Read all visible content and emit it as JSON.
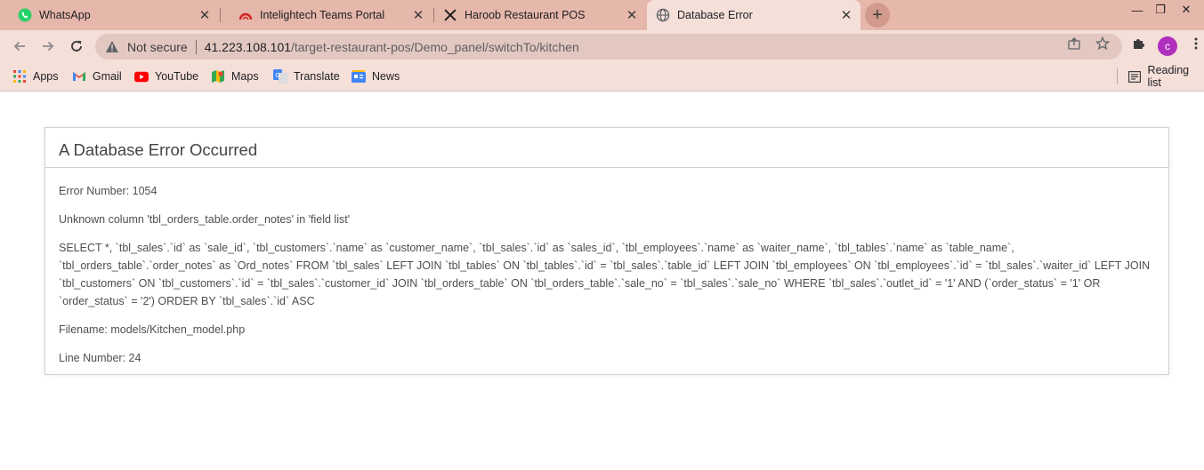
{
  "tabs": [
    {
      "title": "WhatsApp",
      "favicon": "whatsapp-icon",
      "active": false
    },
    {
      "title": "Intelightech Teams Portal",
      "favicon": "teams-portal-icon",
      "active": false
    },
    {
      "title": "Haroob Restaurant POS",
      "favicon": "restaurant-icon",
      "active": false
    },
    {
      "title": "Database Error",
      "favicon": "globe-icon",
      "active": true
    }
  ],
  "tab_close_glyph": "✕",
  "new_tab_glyph": "+",
  "window_controls": {
    "minimize": "—",
    "restore": "❐",
    "close": "✕"
  },
  "address_bar": {
    "security_label": "Not secure",
    "url_host": "41.223.108.101",
    "url_path": "/target-restaurant-pos/Demo_panel/switchTo/kitchen"
  },
  "profile_initial": "c",
  "bookmarks": [
    {
      "label": "Apps",
      "icon": "apps-grid-icon"
    },
    {
      "label": "Gmail",
      "icon": "gmail-icon"
    },
    {
      "label": "YouTube",
      "icon": "youtube-icon"
    },
    {
      "label": "Maps",
      "icon": "maps-icon"
    },
    {
      "label": "Translate",
      "icon": "translate-icon"
    },
    {
      "label": "News",
      "icon": "news-icon"
    }
  ],
  "reading_list_label": "Reading list",
  "error": {
    "heading": "A Database Error Occurred",
    "error_number": "Error Number: 1054",
    "message": "Unknown column 'tbl_orders_table.order_notes' in 'field list'",
    "sql": "SELECT *, `tbl_sales`.`id` as `sale_id`, `tbl_customers`.`name` as `customer_name`, `tbl_sales`.`id` as `sales_id`, `tbl_employees`.`name` as `waiter_name`, `tbl_tables`.`name` as `table_name`, `tbl_orders_table`.`order_notes` as `Ord_notes` FROM `tbl_sales` LEFT JOIN `tbl_tables` ON `tbl_tables`.`id` = `tbl_sales`.`table_id` LEFT JOIN `tbl_employees` ON `tbl_employees`.`id` = `tbl_sales`.`waiter_id` LEFT JOIN `tbl_customers` ON `tbl_customers`.`id` = `tbl_sales`.`customer_id` JOIN `tbl_orders_table` ON `tbl_orders_table`.`sale_no` = `tbl_sales`.`sale_no` WHERE `tbl_sales`.`outlet_id` = '1' AND (`order_status` = '1' OR `order_status` = '2') ORDER BY `tbl_sales`.`id` ASC",
    "filename": "Filename: models/Kitchen_model.php",
    "line_number": "Line Number: 24"
  },
  "colors": {
    "tabstrip": "#e6b7ab",
    "toolbar": "#f5dfd9",
    "omnibox": "#e3c8c1",
    "avatar": "#b02fbd"
  }
}
